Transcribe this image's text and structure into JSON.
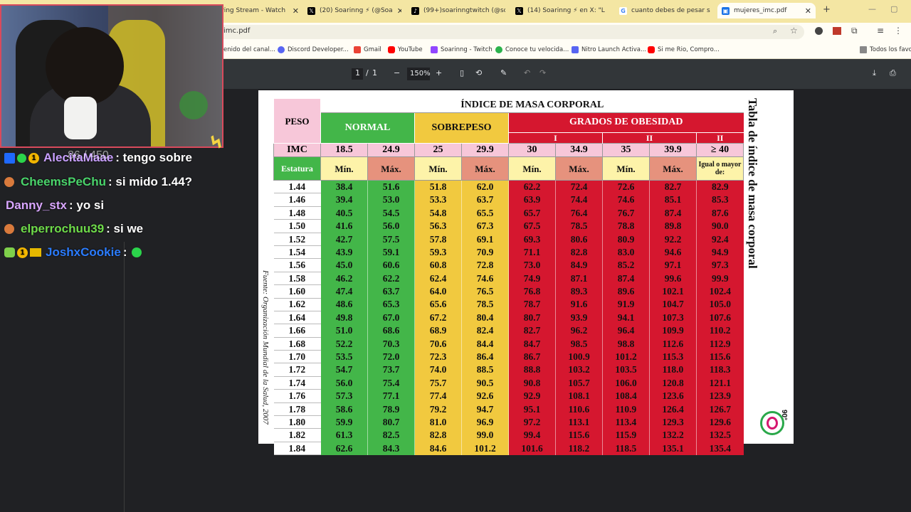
{
  "browser": {
    "tabs": [
      {
        "title": "oaring Stream - Watch",
        "icon": "twitch-icon",
        "color": "#9146ff"
      },
      {
        "title": "(20) Soarinng ⚡ (@Soa",
        "icon": "x-icon",
        "color": "#000000"
      },
      {
        "title": "(99+)soarinngtwitch (@sc",
        "icon": "tiktok-icon",
        "color": "#000000"
      },
      {
        "title": "(14) Soarinng ⚡ en X: \"L",
        "icon": "x-icon",
        "color": "#000000"
      },
      {
        "title": "cuanto debes de pesar se",
        "icon": "google-icon",
        "color": "#4285f4"
      },
      {
        "title": "mujeres_imc.pdf",
        "icon": "pdf-icon",
        "color": "#1a73e8"
      }
    ],
    "address": "imc.pdf",
    "bookmarks": [
      {
        "label": "enido del canal...",
        "color": "#ff0000"
      },
      {
        "label": "Discord Developer...",
        "color": "#5865f2"
      },
      {
        "label": "Gmail",
        "color": "#ea4335"
      },
      {
        "label": "YouTube",
        "color": "#ff0000"
      },
      {
        "label": "Soarinng - Twitch",
        "color": "#9146ff"
      },
      {
        "label": "Conoce tu velocida...",
        "color": "#2bb24c"
      },
      {
        "label": "Nitro Launch Activa...",
        "color": "#5865f2"
      },
      {
        "label": "Si me Rio, Compro...",
        "color": "#ff0000"
      }
    ],
    "all_bookmarks": "Todos los favori"
  },
  "pdf_toolbar": {
    "page_current": "1",
    "page_sep": "/",
    "page_total": "1",
    "zoom": "150%"
  },
  "overlay": {
    "webcam_text": "86 / 450",
    "chat": [
      {
        "user": "AlecitaMaae",
        "msg": ": tengo sobre",
        "color": "#c9a0ff"
      },
      {
        "user": "CheemsPeChu",
        "msg": ": si mido 1.44?",
        "color": "#4ad46b"
      },
      {
        "user": "Danny_stx",
        "msg": ": yo si",
        "color": "#d9a6ff"
      },
      {
        "user": "elperrochuu39",
        "msg": ": si we",
        "color": "#6fdc4a"
      },
      {
        "user": "JoshxCookie",
        "msg": ": ",
        "color": "#2b7cff"
      }
    ]
  },
  "bmi_table": {
    "main_title": "ÍNDICE DE MASA CORPORAL",
    "peso": "PESO",
    "normal": "NORMAL",
    "sobrepeso": "SOBREPESO",
    "obesidad": "GRADOS DE OBESIDAD",
    "grades": [
      "I",
      "II",
      "II"
    ],
    "imc_label": "IMC",
    "imc_values": [
      "18.5",
      "24.9",
      "25",
      "29.9",
      "30",
      "34.9",
      "35",
      "39.9",
      "≥ 40"
    ],
    "estatura": "Estatura",
    "minmax": [
      "Mín.",
      "Máx.",
      "Mín.",
      "Máx.",
      "Mín.",
      "Máx.",
      "Mín.",
      "Máx."
    ],
    "igual": "Igual o mayor de:",
    "rows": [
      [
        "1.44",
        "38.4",
        "51.6",
        "51.8",
        "62.0",
        "62.2",
        "72.4",
        "72.6",
        "82.7",
        "82.9"
      ],
      [
        "1.46",
        "39.4",
        "53.0",
        "53.3",
        "63.7",
        "63.9",
        "74.4",
        "74.6",
        "85.1",
        "85.3"
      ],
      [
        "1.48",
        "40.5",
        "54.5",
        "54.8",
        "65.5",
        "65.7",
        "76.4",
        "76.7",
        "87.4",
        "87.6"
      ],
      [
        "1.50",
        "41.6",
        "56.0",
        "56.3",
        "67.3",
        "67.5",
        "78.5",
        "78.8",
        "89.8",
        "90.0"
      ],
      [
        "1.52",
        "42.7",
        "57.5",
        "57.8",
        "69.1",
        "69.3",
        "80.6",
        "80.9",
        "92.2",
        "92.4"
      ],
      [
        "1.54",
        "43.9",
        "59.1",
        "59.3",
        "70.9",
        "71.1",
        "82.8",
        "83.0",
        "94.6",
        "94.9"
      ],
      [
        "1.56",
        "45.0",
        "60.6",
        "60.8",
        "72.8",
        "73.0",
        "84.9",
        "85.2",
        "97.1",
        "97.3"
      ],
      [
        "1.58",
        "46.2",
        "62.2",
        "62.4",
        "74.6",
        "74.9",
        "87.1",
        "87.4",
        "99.6",
        "99.9"
      ],
      [
        "1.60",
        "47.4",
        "63.7",
        "64.0",
        "76.5",
        "76.8",
        "89.3",
        "89.6",
        "102.1",
        "102.4"
      ],
      [
        "1.62",
        "48.6",
        "65.3",
        "65.6",
        "78.5",
        "78.7",
        "91.6",
        "91.9",
        "104.7",
        "105.0"
      ],
      [
        "1.64",
        "49.8",
        "67.0",
        "67.2",
        "80.4",
        "80.7",
        "93.9",
        "94.1",
        "107.3",
        "107.6"
      ],
      [
        "1.66",
        "51.0",
        "68.6",
        "68.9",
        "82.4",
        "82.7",
        "96.2",
        "96.4",
        "109.9",
        "110.2"
      ],
      [
        "1.68",
        "52.2",
        "70.3",
        "70.6",
        "84.4",
        "84.7",
        "98.5",
        "98.8",
        "112.6",
        "112.9"
      ],
      [
        "1.70",
        "53.5",
        "72.0",
        "72.3",
        "86.4",
        "86.7",
        "100.9",
        "101.2",
        "115.3",
        "115.6"
      ],
      [
        "1.72",
        "54.7",
        "73.7",
        "74.0",
        "88.5",
        "88.8",
        "103.2",
        "103.5",
        "118.0",
        "118.3"
      ],
      [
        "1.74",
        "56.0",
        "75.4",
        "75.7",
        "90.5",
        "90.8",
        "105.7",
        "106.0",
        "120.8",
        "121.1"
      ],
      [
        "1.76",
        "57.3",
        "77.1",
        "77.4",
        "92.6",
        "92.9",
        "108.1",
        "108.4",
        "123.6",
        "123.9"
      ],
      [
        "1.78",
        "58.6",
        "78.9",
        "79.2",
        "94.7",
        "95.1",
        "110.6",
        "110.9",
        "126.4",
        "126.7"
      ],
      [
        "1.80",
        "59.9",
        "80.7",
        "81.0",
        "96.9",
        "97.2",
        "113.1",
        "113.4",
        "129.3",
        "129.6"
      ],
      [
        "1.82",
        "61.3",
        "82.5",
        "82.8",
        "99.0",
        "99.4",
        "115.6",
        "115.9",
        "132.2",
        "132.5"
      ],
      [
        "1.84",
        "62.6",
        "84.3",
        "84.6",
        "101.2",
        "101.6",
        "118.2",
        "118.5",
        "135.1",
        "135.4"
      ]
    ],
    "side_title": "Tabla de índice de masa corporal",
    "source": "Fuente: Organización Mundial de la Salud, 2007",
    "logo_text": "90°"
  }
}
